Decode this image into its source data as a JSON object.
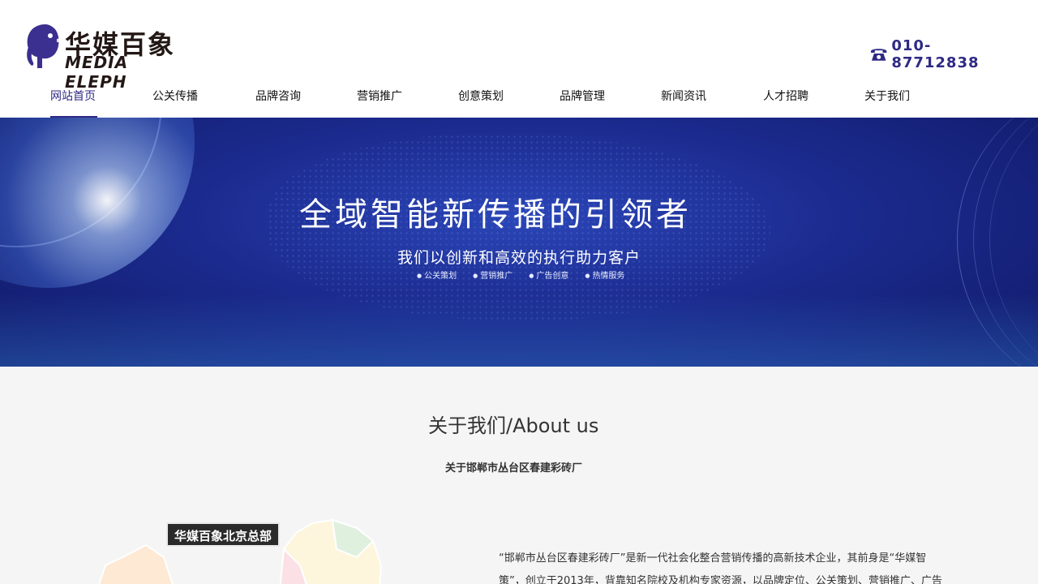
{
  "brand": {
    "name_cn": "华媒百象",
    "name_en": "MEDIA ELEPH",
    "accent_color": "#2f2a84",
    "logo_icon": "elephant-icon"
  },
  "contact": {
    "phone_icon": "phone-icon",
    "phone": "010-87712838"
  },
  "nav": {
    "items": [
      {
        "label": "网站首页",
        "active": true
      },
      {
        "label": "公关传播"
      },
      {
        "label": "品牌咨询"
      },
      {
        "label": "营销推广"
      },
      {
        "label": "创意策划"
      },
      {
        "label": "品牌管理"
      },
      {
        "label": "新闻资讯"
      },
      {
        "label": "人才招聘"
      },
      {
        "label": "关于我们"
      }
    ]
  },
  "banner": {
    "title": "全域智能新传播的引领者",
    "subtitle": "我们以创新和高效的执行助力客户",
    "tags": [
      "公关策划",
      "营销推广",
      "广告创意",
      "热情服务"
    ]
  },
  "about": {
    "title": "关于我们/About us",
    "company": "关于邯郸市丛台区春建彩砖厂",
    "hq_label": "华媒百象北京总部",
    "paragraph_line1": "“邯郸市丛台区春建彩砖厂”是新一代社会化整合营销传播的高新技术企业，其前身是“华媒智",
    "paragraph_line2": "策”，创立于2013年，背靠知名院校及机构专家资源，以品牌定位、公关策划、营销推广、广告"
  }
}
